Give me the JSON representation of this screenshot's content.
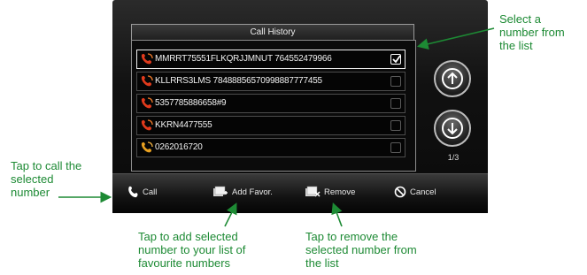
{
  "colors": {
    "annotation": "#1d8a34",
    "screen_bg": "#111111",
    "row_border": "#4c4c4c",
    "phone_icon": "#e03a1c"
  },
  "screen": {
    "title": "Call History",
    "rows": [
      {
        "text": "MMRRT75551FLKQRJJMNUT 764552479966",
        "checked": true,
        "selected": true,
        "icon": "phone-icon"
      },
      {
        "text": "KLLRRS3LMS 78488856570998887777455",
        "checked": false,
        "selected": false,
        "icon": "phone-icon"
      },
      {
        "text": "5357785886658#9",
        "checked": false,
        "selected": false,
        "icon": "phone-icon"
      },
      {
        "text": "KKRN4477555",
        "checked": false,
        "selected": false,
        "icon": "phone-icon"
      },
      {
        "text": "0262016720",
        "checked": false,
        "selected": false,
        "icon": "phone-icon"
      }
    ],
    "page_indicator": "1/3",
    "scroll_up_icon": "arrow-up-icon",
    "scroll_down_icon": "arrow-down-icon",
    "toolbar": {
      "call": "Call",
      "add_favor": "Add Favor.",
      "remove": "Remove",
      "cancel": "Cancel"
    }
  },
  "annotations": {
    "select": [
      "Select a",
      "number from",
      "the list"
    ],
    "call": [
      "Tap to call the",
      "selected",
      "number"
    ],
    "add_favor": [
      "Tap to add selected",
      "number to your list of",
      "favourite numbers"
    ],
    "remove": [
      "Tap to remove the",
      "selected number from",
      "the list"
    ]
  }
}
